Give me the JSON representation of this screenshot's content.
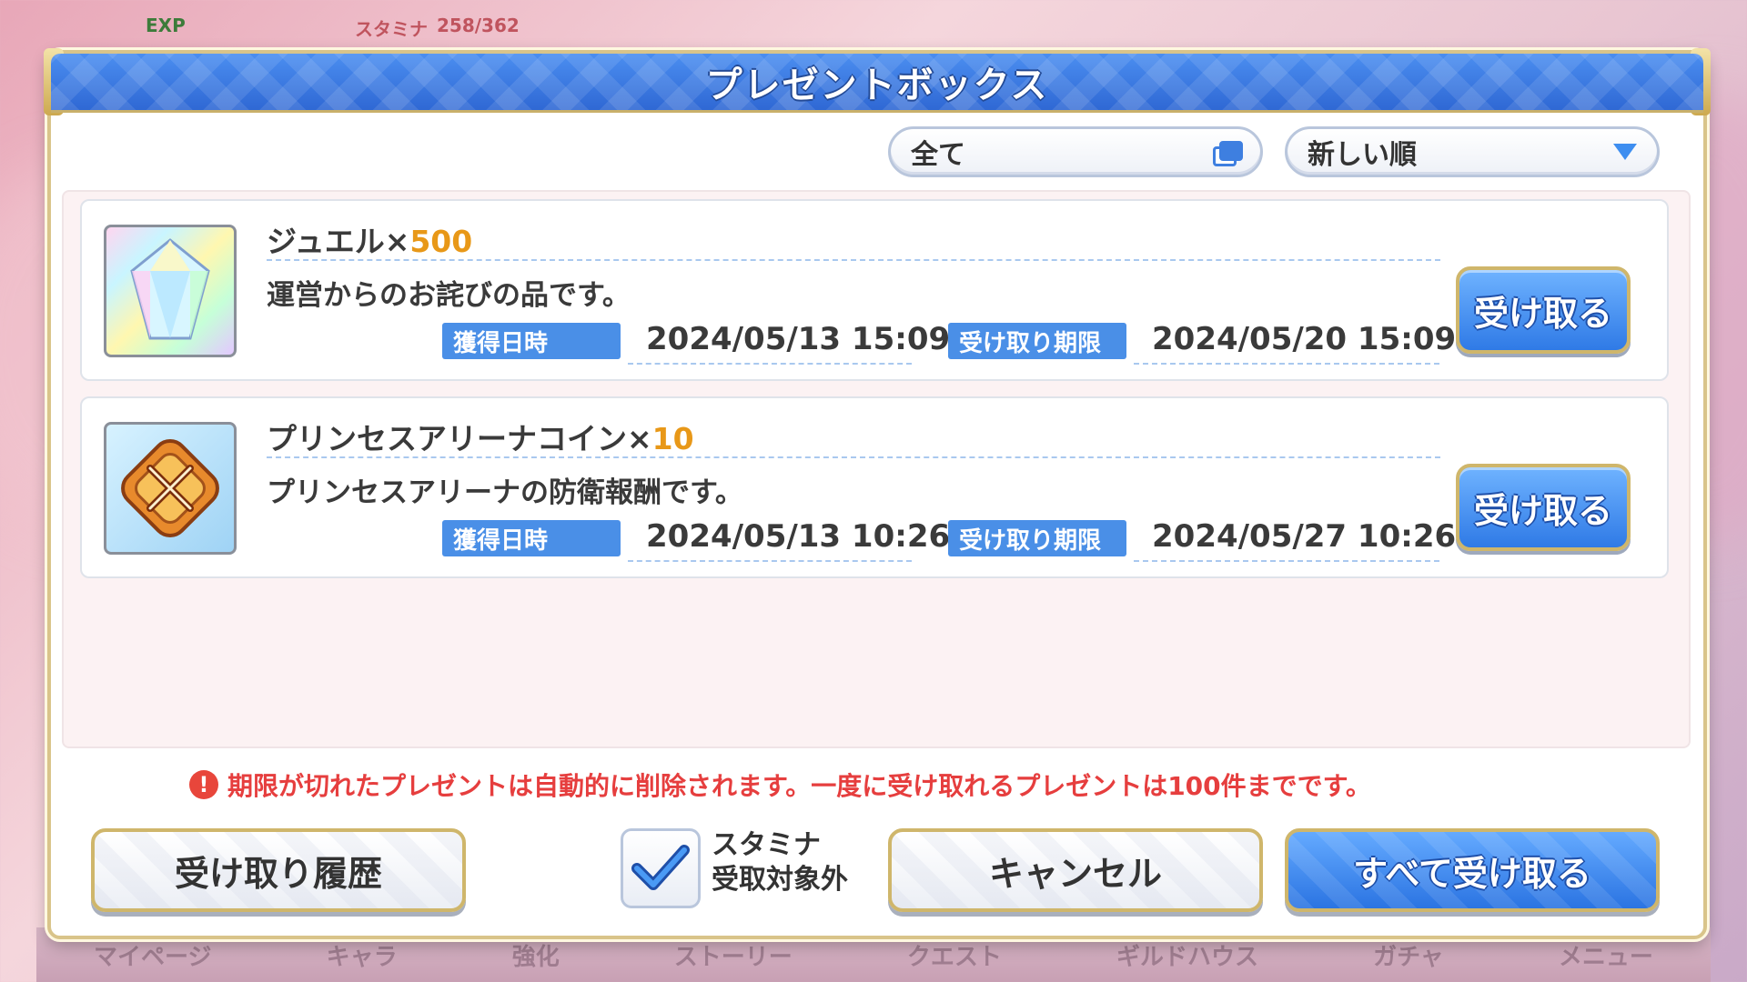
{
  "hud": {
    "exp_label": "EXP",
    "stamina_label": "スタミナ",
    "stamina_value": "258/362"
  },
  "dialog": {
    "title": "プレゼントボックス"
  },
  "filters": {
    "category": "全て",
    "sort": "新しい順"
  },
  "items": [
    {
      "name": "ジュエル×",
      "quantity": "500",
      "description": "運営からのお詫びの品です。",
      "obtained_label": "獲得日時",
      "obtained": "2024/05/13 15:09",
      "deadline_label": "受け取り期限",
      "deadline": "2024/05/20 15:09",
      "receive_label": "受け取る",
      "icon": "jewel-icon"
    },
    {
      "name": "プリンセスアリーナコイン×",
      "quantity": "10",
      "description": "プリンセスアリーナの防衛報酬です。",
      "obtained_label": "獲得日時",
      "obtained": "2024/05/13 10:26",
      "deadline_label": "受け取り期限",
      "deadline": "2024/05/27 10:26",
      "receive_label": "受け取る",
      "icon": "arena-coin-icon"
    }
  ],
  "notice": {
    "icon": "!",
    "text": "期限が切れたプレゼントは自動的に削除されます。一度に受け取れるプレゼントは100件までです。"
  },
  "footer": {
    "history_label": "受け取り履歴",
    "stamina_exclude_line1": "スタミナ",
    "stamina_exclude_line2": "受取対象外",
    "stamina_exclude_checked": true,
    "cancel_label": "キャンセル",
    "receive_all_label": "すべて受け取る"
  },
  "nav": {
    "items": [
      "マイページ",
      "キャラ",
      "強化",
      "ストーリー",
      "クエスト",
      "ギルドハウス",
      "ガチャ",
      "メニュー"
    ]
  },
  "colors": {
    "accent_blue": "#2f7ae6",
    "quantity_orange": "#e89818",
    "notice_red": "#e63e3e",
    "gold_border": "#cfb66b"
  }
}
